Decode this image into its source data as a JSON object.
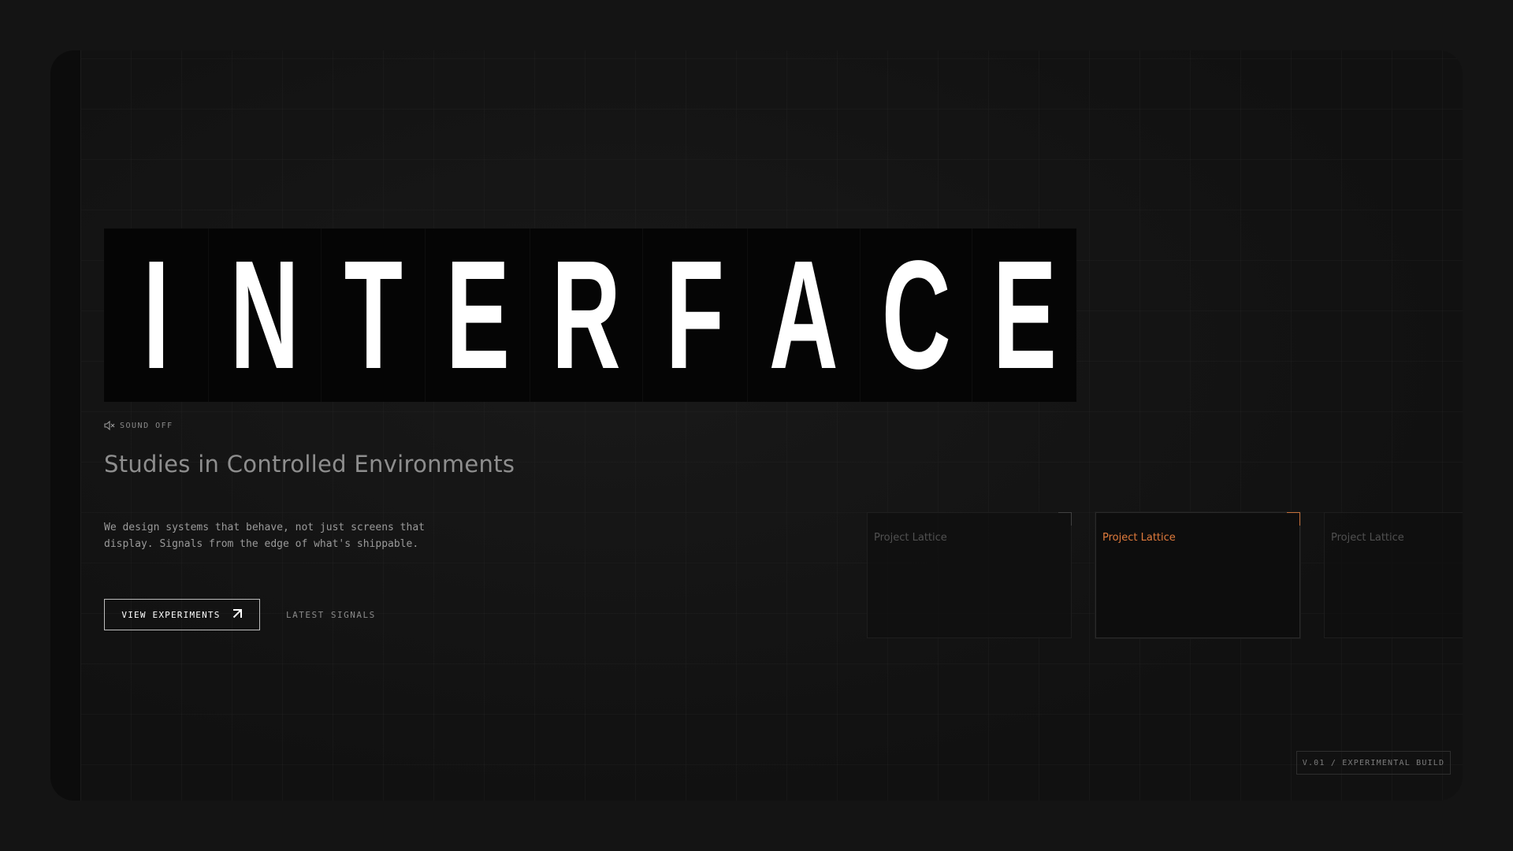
{
  "hero": {
    "letters": [
      "I",
      "N",
      "T",
      "E",
      "R",
      "F",
      "A",
      "C",
      "E"
    ]
  },
  "sound": {
    "label": "SOUND OFF",
    "icon": "speaker-muted-icon"
  },
  "subtitle": "Studies in Controlled Environments",
  "description": {
    "line1": "We design systems that behave, not just screens that",
    "line2": "display. Signals from the edge of what's shippable."
  },
  "actions": {
    "primary_label": "VIEW EXPERIMENTS",
    "primary_icon": "arrow-up-right-icon",
    "secondary_label": "LATEST SIGNALS"
  },
  "cards": [
    {
      "title": "Project Lattice",
      "state": "inactive"
    },
    {
      "title": "Project Lattice",
      "state": "active"
    },
    {
      "title": "Project Lattice",
      "state": "inactive"
    }
  ],
  "version": "V.01 / EXPERIMENTAL BUILD",
  "colors": {
    "background": "#141414",
    "frame": "#111111",
    "accent": "#e07b3c",
    "hero_text": "#ffffff"
  }
}
